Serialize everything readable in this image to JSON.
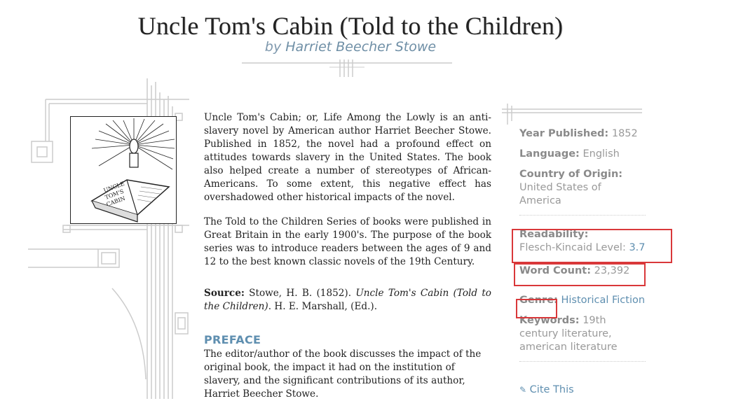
{
  "book": {
    "title": "Uncle Tom's Cabin (Told to the Children)",
    "by": "by",
    "author": "Harriet Beecher Stowe"
  },
  "cover": {
    "alt": "Uncle Tom's Cabin book illustration",
    "book_text": "UNCLE TOM'S CABIN"
  },
  "description": {
    "p1": "Uncle Tom's Cabin; or, Life Among the Lowly is an anti-slavery novel by American author Harriet Beecher Stowe. Published in 1852, the novel had a profound effect on attitudes towards slavery in the United States. The book also helped create a number of stereotypes of African-Americans. To some extent, this negative effect has overshadowed other historical impacts of the novel.",
    "p2": "The Told to the Children Series of books were published in Great Britain in the early 1900's. The purpose of the book series was to introduce readers between the ages of 9 and 12 to the best known classic novels of the 19th Century.",
    "source_label": "Source:",
    "source_pre": "Stowe, H. B. (1852).",
    "source_title": "Uncle Tom's Cabin (Told to the Children)",
    "source_post": ". H. E. Marshall, (Ed.)."
  },
  "preface": {
    "heading": "PREFACE",
    "text": "The editor/author of the book discusses the impact of the original book, the impact it had on the institution of slavery, and the significant contributions of its author, Harriet Beecher Stowe."
  },
  "meta": {
    "year_label": "Year Published:",
    "year": "1852",
    "language_label": "Language:",
    "language": "English",
    "country_label": "Country of Origin:",
    "country": "United States of America",
    "readability_label": "Readability:",
    "readability_text": "Flesch-Kincaid Level:",
    "readability_value": "3.7",
    "word_count_label": "Word Count:",
    "word_count": "23,392",
    "genre_label": "Genre:",
    "genre": "Historical Fiction",
    "keywords_label": "Keywords:",
    "keywords": "19th century literature, american literature",
    "cite": "Cite This"
  },
  "colors": {
    "accent": "#5f8fb0",
    "highlight": "#d9383a"
  }
}
